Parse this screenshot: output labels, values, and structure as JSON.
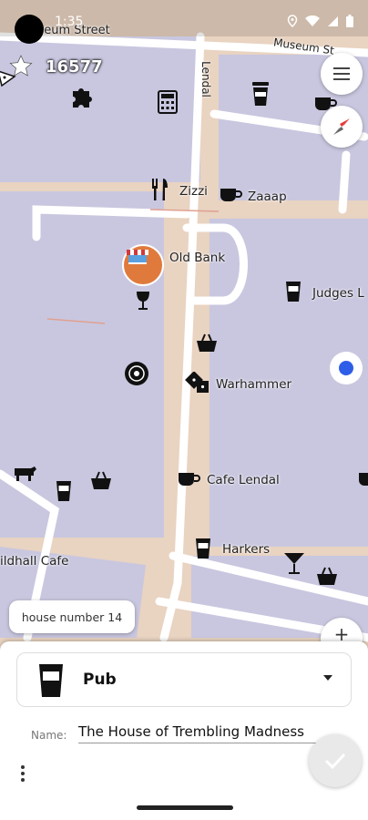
{
  "status_bar": {
    "time": "1:35"
  },
  "map": {
    "street_labels": [
      "Museum Street",
      "Museum St",
      "Lendal"
    ],
    "place_labels": [
      "Zizzi",
      "Zaaap",
      "Old Bank",
      "Judges L",
      "Warhammer",
      "Cafe Lendal",
      "Harkers",
      "ildhall Cafe"
    ]
  },
  "score": {
    "value": "16577"
  },
  "tooltip": {
    "text": "house number 14"
  },
  "panel": {
    "feature_type": "Pub",
    "name_label": "Name:",
    "name_value": "The House of Trembling Madness"
  },
  "colors": {
    "accent": "#e05a2b",
    "location": "#2e5ee8",
    "map_land": "#e9d3c1",
    "building": "#c9c7df",
    "road": "#ffffff"
  }
}
